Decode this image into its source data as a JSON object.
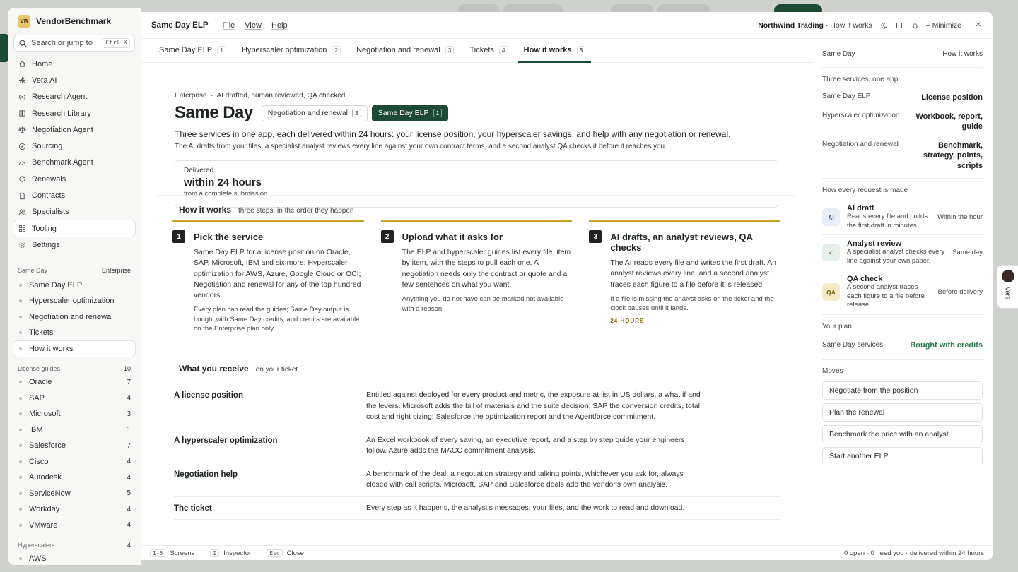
{
  "brand": {
    "logo": "VB",
    "name": "VendorBenchmark"
  },
  "search": {
    "placeholder": "Search or jump to",
    "shortcut": "Ctrl K"
  },
  "nav": [
    {
      "label": "Home",
      "icon": "home-icon"
    },
    {
      "label": "Vera AI",
      "icon": "sparkle-icon"
    },
    {
      "label": "Research Agent",
      "icon": "radio-icon"
    },
    {
      "label": "Research Library",
      "icon": "book-icon"
    },
    {
      "label": "Negotiation Agent",
      "icon": "scale-icon"
    },
    {
      "label": "Sourcing",
      "icon": "compass-icon"
    },
    {
      "label": "Benchmark Agent",
      "icon": "gauge-icon"
    },
    {
      "label": "Renewals",
      "icon": "refresh-icon"
    },
    {
      "label": "Contracts",
      "icon": "document-icon"
    },
    {
      "label": "Specialists",
      "icon": "users-icon"
    },
    {
      "label": "Tooling",
      "icon": "grid-icon"
    },
    {
      "label": "Settings",
      "icon": "gear-icon"
    }
  ],
  "same_day_section": {
    "title": "Same Day",
    "badge": "Enterprise",
    "items": [
      "Same Day ELP",
      "Hyperscaler optimization",
      "Negotiation and renewal",
      "Tickets",
      "How it works"
    ]
  },
  "license_guides": {
    "title": "License guides",
    "count": "10",
    "items": [
      {
        "label": "Oracle",
        "count": "7"
      },
      {
        "label": "SAP",
        "count": "4"
      },
      {
        "label": "Microsoft",
        "count": "3"
      },
      {
        "label": "IBM",
        "count": "1"
      },
      {
        "label": "Salesforce",
        "count": "7"
      },
      {
        "label": "Cisco",
        "count": "4"
      },
      {
        "label": "Autodesk",
        "count": "4"
      },
      {
        "label": "ServiceNow",
        "count": "5"
      },
      {
        "label": "Workday",
        "count": "4"
      },
      {
        "label": "VMware",
        "count": "4"
      }
    ]
  },
  "hyperscalers": {
    "title": "Hyperscalers",
    "count": "4",
    "items": [
      {
        "label": "AWS"
      }
    ]
  },
  "menubar": {
    "title": "Same Day ELP",
    "menus": [
      "File",
      "View",
      "Help"
    ],
    "org": "Northwind Trading",
    "context": "· How it works",
    "minimize": "Minimize"
  },
  "tabs": [
    {
      "label": "Same Day ELP",
      "n": "1"
    },
    {
      "label": "Hyperscaler optimization",
      "n": "2"
    },
    {
      "label": "Negotiation and renewal",
      "n": "3"
    },
    {
      "label": "Tickets",
      "n": "4"
    },
    {
      "label": "How it works",
      "n": "5"
    }
  ],
  "hero": {
    "eyebrow_a": "Enterprise",
    "eyebrow_b": "AI drafted, human reviewed, QA checked",
    "title": "Same Day",
    "chip1": {
      "label": "Negotiation and renewal",
      "n": "3"
    },
    "chip2": {
      "label": "Same Day ELP",
      "n": "1"
    },
    "lead": "Three services in one app, each delivered within 24 hours: your license position, your hyperscaler savings, and help with any negotiation or renewal.",
    "lead2": "The AI drafts from your files, a specialist analyst reviews every line against your own contract terms, and a second analyst QA checks it before it reaches you.",
    "delivered": {
      "label": "Delivered",
      "value": "within 24 hours",
      "sub": "from a complete submission"
    }
  },
  "how": {
    "title": "How it works",
    "sub": "three steps, in the order they happen",
    "steps": [
      {
        "n": "1",
        "title": "Pick the service",
        "p": "Same Day ELP for a license position on Oracle, SAP, Microsoft, IBM and six more; Hyperscaler optimization for AWS, Azure, Google Cloud or OCI; Negotiation and renewal for any of the top hundred vendors.",
        "s": "Every plan can read the guides; Same Day output is bought with Same Day credits, and credits are available on the Enterprise plan only.",
        "tag": ""
      },
      {
        "n": "2",
        "title": "Upload what it asks for",
        "p": "The ELP and hyperscaler guides list every file, item by item, with the steps to pull each one. A negotiation needs only the contract or quote and a few sentences on what you want.",
        "s": "Anything you do not have can be marked not available with a reason.",
        "tag": ""
      },
      {
        "n": "3",
        "title": "AI drafts, an analyst reviews, QA checks",
        "p": "The AI reads every file and writes the first draft. An analyst reviews every line, and a second analyst traces each figure to a file before it is released.",
        "s": "If a file is missing the analyst asks on the ticket and the clock pauses until it lands.",
        "tag": "24 HOURS"
      }
    ]
  },
  "receive": {
    "title": "What you receive",
    "sub": "on your ticket",
    "rows": [
      {
        "k": "A license position",
        "v": "Entitled against deployed for every product and metric, the exposure at list in US dollars, a what if and the levers. Microsoft adds the bill of materials and the suite decision; SAP the conversion credits, total cost and right sizing; Salesforce the optimization report and the Agentforce commitment."
      },
      {
        "k": "A hyperscaler optimization",
        "v": "An Excel workbook of every saving, an executive report, and a step by step guide your engineers follow. Azure adds the MACC commitment analysis."
      },
      {
        "k": "Negotiation help",
        "v": "A benchmark of the deal, a negotiation strategy and talking points, whichever you ask for, always closed with call scripts. Microsoft, SAP and Salesforce deals add the vendor's own analysis."
      },
      {
        "k": "The ticket",
        "v": "Every step as it happens, the analyst's messages, your files, and the work to read and download."
      }
    ]
  },
  "panel": {
    "top": {
      "k": "Same Day",
      "v": "How it works"
    },
    "services_title": "Three services, one app",
    "services": [
      {
        "k": "Same Day ELP",
        "v": "License position"
      },
      {
        "k": "Hyperscaler optimization",
        "v": "Workbook, report, guide"
      },
      {
        "k": "Negotiation and renewal",
        "v": "Benchmark, strategy, points, scripts"
      }
    ],
    "process_title": "How every request is made",
    "process": [
      {
        "badge": "AI",
        "title": "AI draft",
        "desc": "Reads every file and builds the first draft in minutes.",
        "time": "Within the hour",
        "bg": "#e8eef8",
        "fg": "#3a5a8c"
      },
      {
        "badge": "✓",
        "title": "Analyst review",
        "desc": "A specialist analyst checks every line against your own paper.",
        "time": "Same day",
        "bg": "#e6efe8",
        "fg": "#2f6b46"
      },
      {
        "badge": "QA",
        "title": "QA check",
        "desc": "A second analyst traces each figure to a file before release.",
        "time": "Before delivery",
        "bg": "#f6ecc8",
        "fg": "#7a5c0c"
      }
    ],
    "plan_title": "Your plan",
    "plan": {
      "k": "Same Day services",
      "v": "Bought with credits",
      "color": "#2f7a4c"
    },
    "moves_title": "Moves",
    "moves": [
      "Negotiate from the position",
      "Plan the renewal",
      "Benchmark the price with an analyst",
      "Start another ELP"
    ]
  },
  "status": {
    "k1": "1-5",
    "l1": "Screens",
    "k2": "I",
    "l2": "Inspector",
    "k3": "Esc",
    "l3": "Close",
    "right": "0 open · 0 need you · delivered within 24 hours"
  },
  "vera": {
    "label": "Vera"
  }
}
